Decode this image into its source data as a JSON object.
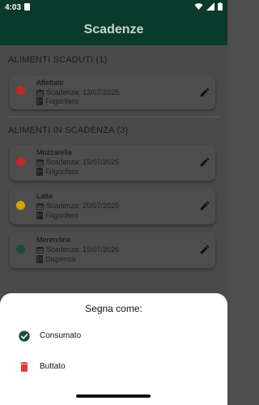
{
  "status_bar": {
    "time": "4:03"
  },
  "app_bar": {
    "title": "Scadenze"
  },
  "sections": {
    "expired": {
      "title": "ALIMENTI SCADUTI (1)",
      "items": [
        {
          "name": "Affettato",
          "expiry": "Scadenza: 13/07/2025",
          "location": "Frigorifero",
          "status_color": "#c62828"
        }
      ]
    },
    "expiring": {
      "title": "ALIMENTI IN SCADENZA (3)",
      "items": [
        {
          "name": "Mozzarella",
          "expiry": "Scadenza: 15/07/2025",
          "location": "Frigorifero",
          "status_color": "#c62828"
        },
        {
          "name": "Latte",
          "expiry": "Scadenza: 20/07/2025",
          "location": "Frigorifero",
          "status_color": "#d9a400"
        },
        {
          "name": "Merendine",
          "expiry": "Scadenza: 15/07/2026",
          "location": "Dispensa",
          "status_color": "#1b4d3b"
        }
      ]
    }
  },
  "bottom_sheet": {
    "title": "Segna come:",
    "options": [
      {
        "label": "Consumato",
        "icon": "check-circle-icon",
        "color": "#1b4d3b"
      },
      {
        "label": "Buttato",
        "icon": "trash-icon",
        "color": "#e53935"
      }
    ]
  },
  "colors": {
    "appbar": "#0b3a2c",
    "scrim": "#4a4a4a"
  }
}
